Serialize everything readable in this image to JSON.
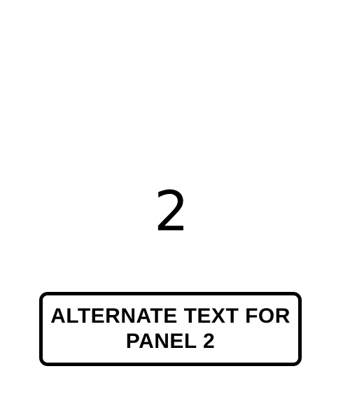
{
  "panel": {
    "number": "2",
    "alt_text_lines": [
      "ALTERNATE TEXT FOR",
      "PANEL 2"
    ]
  },
  "colors": {
    "background": "#ffffff",
    "foreground": "#000000"
  }
}
